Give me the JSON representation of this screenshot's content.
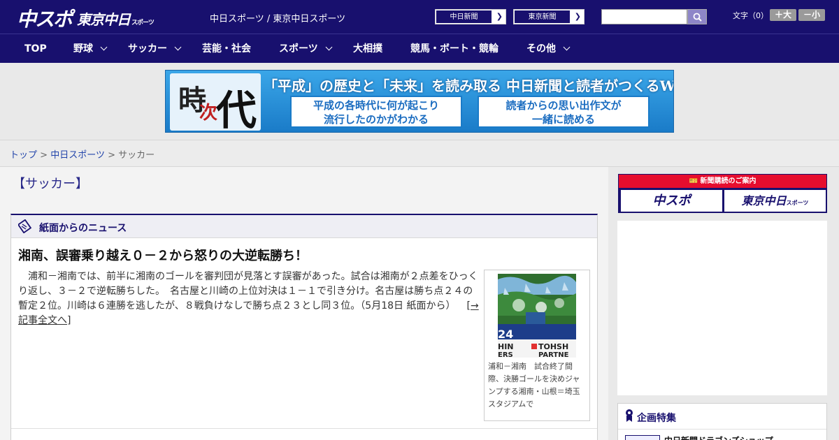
{
  "header": {
    "logo_primary": "中スポ",
    "logo_secondary": "東京中日",
    "logo_secondary_suffix": "スポーツ",
    "site_names": "中日スポーツ / 東京中日スポーツ",
    "ext_links": [
      {
        "label": "中日新聞"
      },
      {
        "label": "東京新聞"
      }
    ],
    "search": {
      "value": "",
      "placeholder": ""
    },
    "text_size": {
      "label": "文字（0）",
      "increase": "＋大",
      "decrease": "－小"
    }
  },
  "nav": {
    "items": [
      {
        "label": "TOP",
        "has_dropdown": false
      },
      {
        "label": "野球",
        "has_dropdown": true
      },
      {
        "label": "サッカー",
        "has_dropdown": true
      },
      {
        "label": "芸能・社会",
        "has_dropdown": false
      },
      {
        "label": "スポーツ",
        "has_dropdown": true
      },
      {
        "label": "大相撲",
        "has_dropdown": false
      },
      {
        "label": "競馬・ボート・競輪",
        "has_dropdown": false
      },
      {
        "label": "その他",
        "has_dropdown": true
      }
    ]
  },
  "banner": {
    "kanji_1": "時",
    "kanji_2": "次",
    "kanji_3": "代",
    "headline": "「平成」の歴史と「未来」を読み取る 中日新聞と読者がつくるWebサイト",
    "pill_left_1": "平成の各時代に何が起こり",
    "pill_left_2": "流行したのかがわかる",
    "pill_right_1": "読者からの思い出作文が",
    "pill_right_2": "一緒に読める"
  },
  "breadcrumb": {
    "items": [
      "トップ",
      "中日スポーツ"
    ],
    "separator": ">",
    "current": "サッカー"
  },
  "main": {
    "page_title": "【サッカー】",
    "news_section_title": "紙面からのニュース",
    "article": {
      "title": "湘南、誤審乗り越え０－２から怒りの大逆転勝ち！",
      "body": "　浦和－湘南では、前半に湘南のゴールを審判団が見落とす誤審があった。試合は湘南が２点差をひっくり返し、３－２で逆転勝ちした。　名古屋と川崎の上位対決は１－１で引き分け。名古屋は勝ち点２４の暫定２位。川崎は６連勝を逃したが、８戦負けなしで勝ち点２３とし同３位。（5月18日 紙面から）",
      "more_link": "[→記事全文へ]",
      "photo_caption": "浦和－湘南　試合終了間際、決勝ゴールを決めジャンプする湘南・山根＝埼玉スタジアムで",
      "photo_sign_1": "24",
      "photo_sign_2": "HIN",
      "photo_sign_3": "TOHSH",
      "photo_sign_4": "ERS",
      "photo_sign_5": "PARTNE"
    }
  },
  "sidebar": {
    "subscribe_bar": "新聞購読のご案内",
    "subscribe_left": "中スポ",
    "subscribe_right": "東京中日",
    "subscribe_right_suffix": "スポーツ",
    "feature_title": "企画特集",
    "feature_item": "中日新聞ドラゴンズショップ"
  },
  "colors": {
    "brand_navy": "#18106e",
    "accent_red": "#e60d2e",
    "banner_blue": "#1a7bc8"
  }
}
